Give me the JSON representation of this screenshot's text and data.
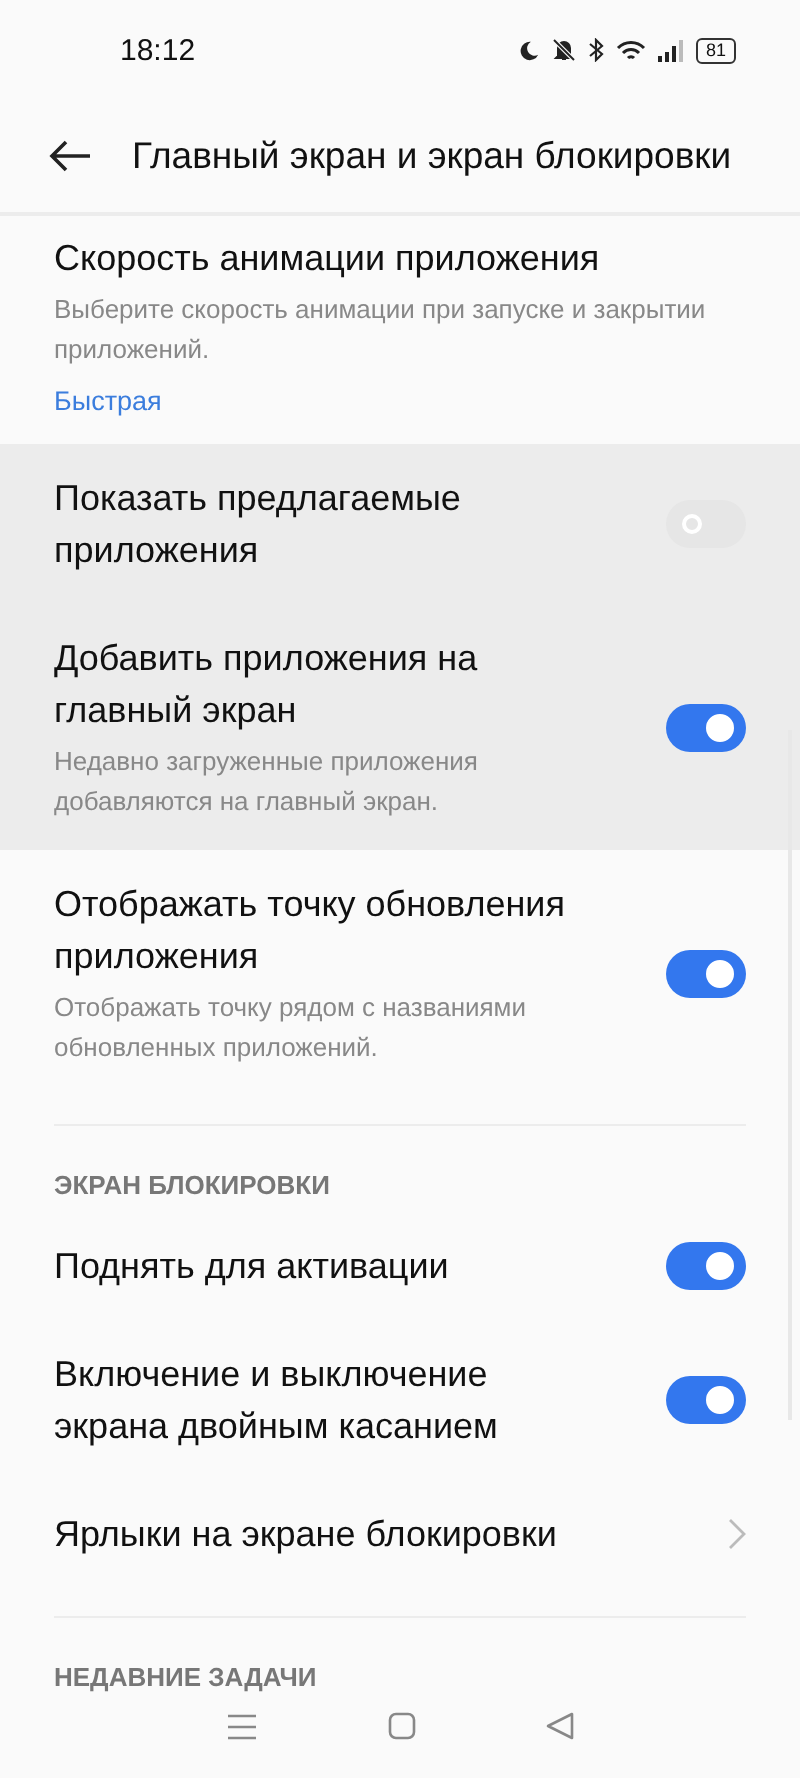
{
  "status_bar": {
    "time": "18:12",
    "battery": "81"
  },
  "header": {
    "title": "Главный экран и экран блокировки"
  },
  "sections": [
    {
      "items": [
        {
          "kind": "value",
          "title": "Скорость анимации приложения",
          "description": "Выберите скорость анимации при запуске и закрытии приложений.",
          "value": "Быстрая",
          "highlighted": false
        },
        {
          "kind": "toggle",
          "title": "Показать предлагаемые приложения",
          "on": false,
          "highlighted": true
        },
        {
          "kind": "toggle",
          "title": "Добавить приложения на главный экран",
          "description": "Недавно загруженные приложения добавляются на главный экран.",
          "on": true,
          "highlighted": true
        },
        {
          "kind": "toggle",
          "title": "Отображать точку обновления приложения",
          "description": "Отображать точку рядом с названиями обновленных приложений.",
          "on": true,
          "highlighted": false
        }
      ]
    },
    {
      "heading": "ЭКРАН БЛОКИРОВКИ",
      "items": [
        {
          "kind": "toggle",
          "title": "Поднять для активации",
          "on": true,
          "highlighted": false
        },
        {
          "kind": "toggle",
          "title": "Включение и выключение экрана двойным касанием",
          "on": true,
          "highlighted": false
        },
        {
          "kind": "link",
          "title": "Ярлыки на экране блокировки",
          "highlighted": false
        }
      ]
    },
    {
      "heading": "НЕДАВНИЕ ЗАДАЧИ"
    }
  ]
}
